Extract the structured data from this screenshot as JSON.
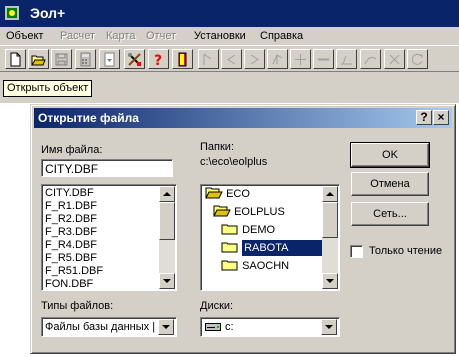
{
  "app": {
    "title": "Эол+",
    "menu": [
      {
        "label": "Объект",
        "enabled": true
      },
      {
        "label": "Расчет",
        "enabled": false
      },
      {
        "label": "Карта",
        "enabled": false
      },
      {
        "label": "Отчет",
        "enabled": false
      },
      {
        "label": "Установки",
        "enabled": true
      },
      {
        "label": "Справка",
        "enabled": true
      }
    ],
    "toolbar_icons": [
      "new-file-icon",
      "open-folder-icon",
      "save-icon",
      "calculator-icon",
      "dropdown-doc-icon",
      "tools-icon",
      "help-question-icon",
      "exit-door-icon",
      "node-icon",
      "left-arrow-icon",
      "right-arrow-icon",
      "branch-icon",
      "move-icon",
      "line-icon",
      "triangle-icon",
      "curve-icon",
      "cross-icon",
      "refresh-icon"
    ],
    "tooltip": "Открыть объект"
  },
  "dialog": {
    "title": "Открытие файла",
    "help_btn": "?",
    "close_btn": "×",
    "filename_label": "Имя файла:",
    "filename_value": "CITY.DBF",
    "files": [
      "CITY.DBF",
      "F_R1.DBF",
      "F_R2.DBF",
      "F_R3.DBF",
      "F_R4.DBF",
      "F_R5.DBF",
      "F_R51.DBF",
      "FON.DBF"
    ],
    "folders_label": "Папки:",
    "current_path": "c:\\eco\\eolplus",
    "folders": [
      {
        "name": "ECO",
        "open": true,
        "selected": false
      },
      {
        "name": "EOLPLUS",
        "open": true,
        "selected": false
      },
      {
        "name": "DEMO",
        "open": false,
        "selected": false
      },
      {
        "name": "RABOTA",
        "open": false,
        "selected": true
      },
      {
        "name": "SAOCHN",
        "open": false,
        "selected": false
      }
    ],
    "ok_label": "OK",
    "cancel_label": "Отмена",
    "network_label": "Сеть...",
    "readonly_label": "Только чтение",
    "readonly_checked": false,
    "filetypes_label": "Типы файлов:",
    "filetype_value": "Файлы базы данных |",
    "drives_label": "Диски:",
    "drive_value": "c:"
  },
  "colors": {
    "titlebar": "#0a246a",
    "dialog_gradient_end": "#a6caf0",
    "face": "#d4d0c8",
    "tooltip_bg": "#ffffe1",
    "selection": "#0a246a"
  }
}
